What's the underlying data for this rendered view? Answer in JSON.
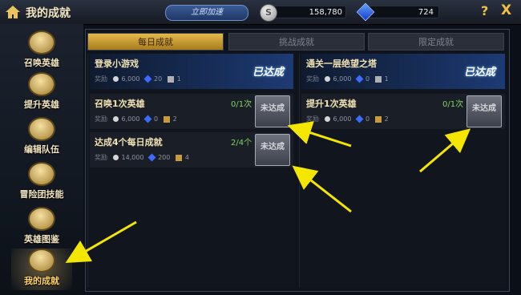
{
  "header": {
    "title": "我的成就",
    "recharge_label": "立即加速",
    "silver_amount": "158,780",
    "gem_amount": "724",
    "help": "?",
    "close": "X"
  },
  "sidebar": {
    "items": [
      {
        "label": "召唤英雄",
        "icon": "summon-icon"
      },
      {
        "label": "提升英雄",
        "icon": "levelup-icon"
      },
      {
        "label": "编辑队伍",
        "icon": "team-icon"
      },
      {
        "label": "冒险团技能",
        "icon": "skill-icon"
      },
      {
        "label": "英雄图鉴",
        "icon": "book-icon"
      },
      {
        "label": "我的成就",
        "icon": "achievement-icon",
        "active": true
      }
    ]
  },
  "tabs": [
    {
      "label": "每日成就",
      "active": true
    },
    {
      "label": "挑战成就"
    },
    {
      "label": "限定成就"
    }
  ],
  "left_column": [
    {
      "title": "登录小游戏",
      "status": "已达成",
      "reward_label": "奖励",
      "silver": "6,000",
      "gem": "20",
      "box": "1"
    },
    {
      "title": "召唤1次英雄",
      "progress": "0/1次",
      "reward_label": "奖励",
      "silver": "6,000",
      "gem": "0",
      "gold": "2",
      "button": "未达成"
    },
    {
      "title": "达成4个每日成就",
      "progress": "2/4个",
      "reward_label": "奖励",
      "silver": "14,000",
      "gem": "200",
      "gold": "4",
      "button": "未达成"
    }
  ],
  "right_column": [
    {
      "title": "通关一层绝望之塔",
      "status": "已达成",
      "reward_label": "奖励",
      "silver": "6,000",
      "gem": "0",
      "box": "1"
    },
    {
      "title": "提升1次英雄",
      "progress": "0/1次",
      "reward_label": "奖励",
      "silver": "6,000",
      "gem": "0",
      "gold": "2",
      "button": "未达成"
    }
  ],
  "colors": {
    "accent_gold": "#e3b84a",
    "arrow": "#f5e600",
    "done_blue": "#1c3a74"
  }
}
